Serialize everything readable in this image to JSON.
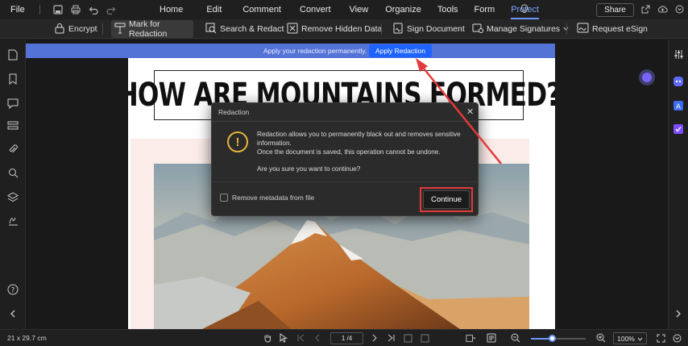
{
  "menubar": {
    "file_label": "File",
    "menus": [
      "Home",
      "Edit",
      "Comment",
      "Convert",
      "View",
      "Organize",
      "Tools",
      "Form",
      "Protect"
    ],
    "active_menu": "Protect",
    "share_label": "Share"
  },
  "toolbar": {
    "encrypt": "Encrypt",
    "mark_for_redaction": "Mark for Redaction",
    "search_redact": "Search & Redact",
    "remove_hidden_data": "Remove Hidden Data",
    "sign_document": "Sign Document",
    "manage_signatures": "Manage Signatures",
    "request_esign": "Request eSign"
  },
  "banner": {
    "message": "Apply your redaction permanently.",
    "apply_label": "Apply Redaction"
  },
  "document": {
    "title": "HOW ARE MOUNTAINS FORMED?"
  },
  "dialog": {
    "title": "Redaction",
    "line1": "Redaction allows you to permanently black out and removes sensitive information.",
    "line2": "Once the document is saved, this operation cannot be undone.",
    "line3": "Are you sure you want to continue?",
    "checkbox_label": "Remove metadata from file",
    "checkbox_checked": false,
    "continue_label": "Continue"
  },
  "statusbar": {
    "page_size": "21 x 29.7 cm",
    "page_indicator": "1 /4",
    "zoom": "100%",
    "zoom_level": 0.4
  },
  "colors": {
    "accent": "#1f63ff",
    "banner": "#5473d6",
    "highlight_red": "#e23a3a",
    "warning": "#e5b43a"
  }
}
